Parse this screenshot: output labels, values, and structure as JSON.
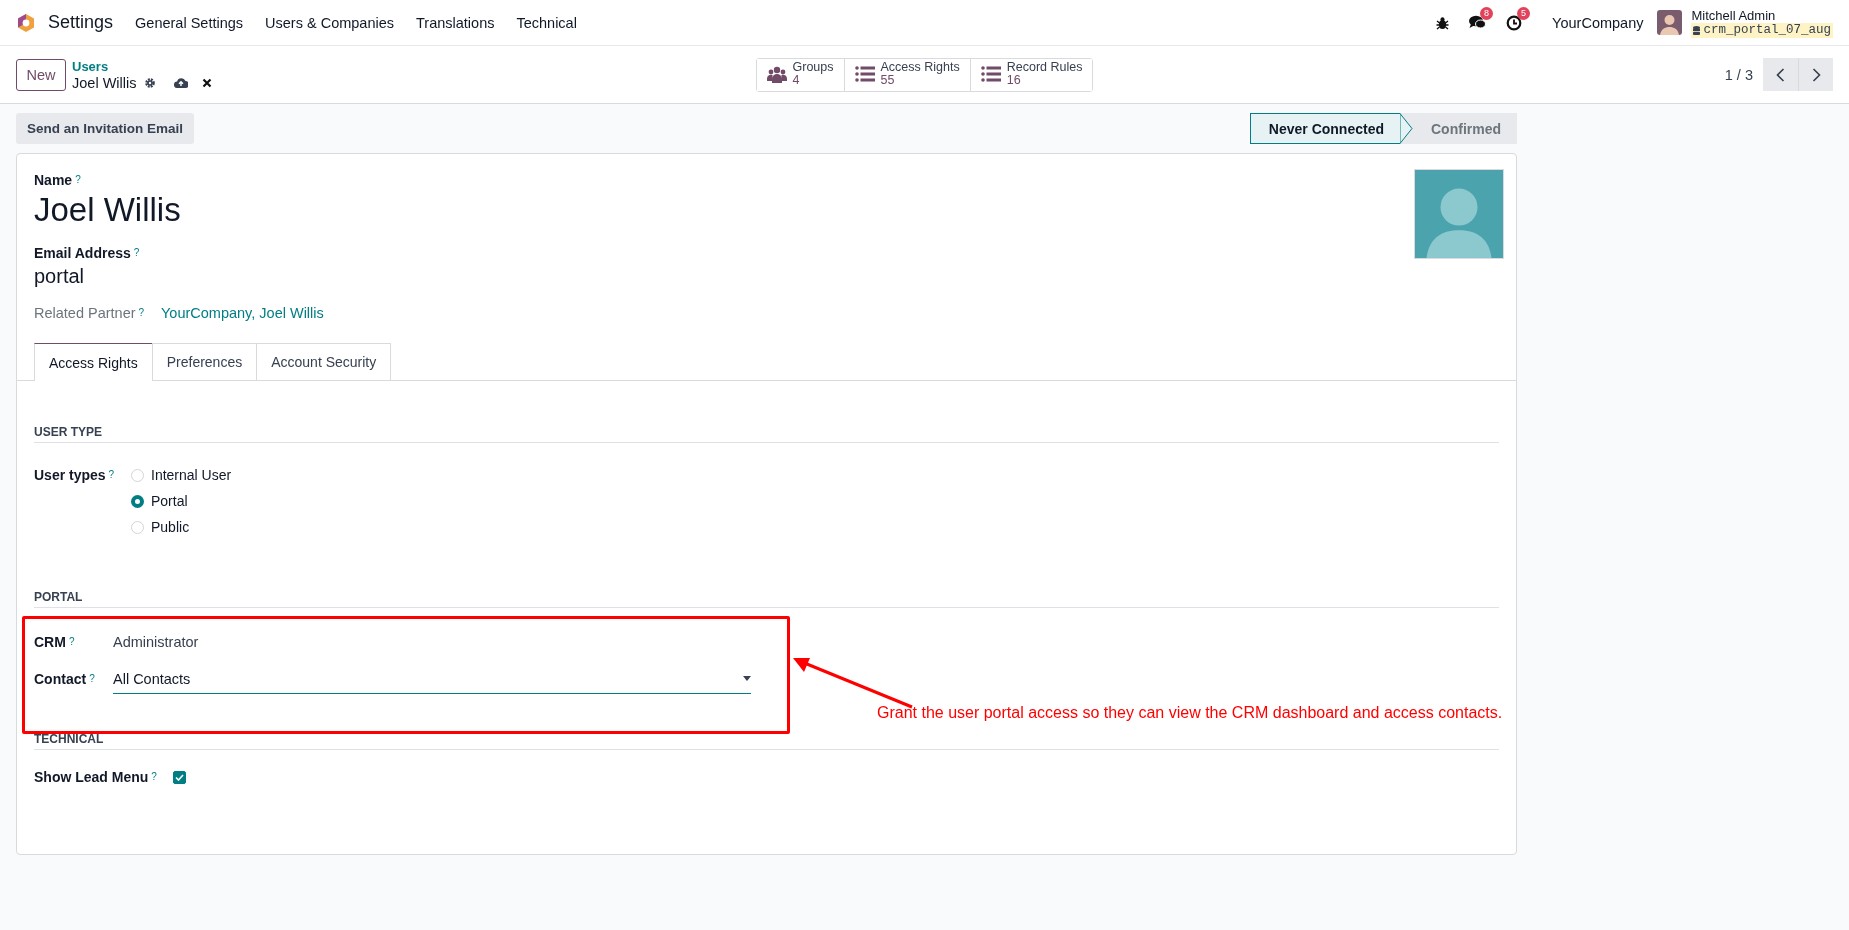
{
  "navbar": {
    "app_name": "Settings",
    "menu": [
      "General Settings",
      "Users & Companies",
      "Translations",
      "Technical"
    ],
    "messages_count": "8",
    "activities_count": "5",
    "company": "YourCompany",
    "user_name": "Mitchell Admin",
    "database": "crm_portal_07_aug"
  },
  "control_panel": {
    "new_button": "New",
    "breadcrumb_parent": "Users",
    "record_title": "Joel Willis",
    "smart_buttons": [
      {
        "kind": "groups",
        "label": "Groups",
        "count": "4"
      },
      {
        "kind": "list",
        "label": "Access Rights",
        "count": "55"
      },
      {
        "kind": "list",
        "label": "Record Rules",
        "count": "16"
      }
    ],
    "pager": "1 / 3"
  },
  "status_bar": {
    "action_button": "Send an Invitation Email",
    "stages": [
      {
        "label": "Never Connected",
        "selected": true
      },
      {
        "label": "Confirmed",
        "selected": false
      }
    ]
  },
  "form": {
    "name": {
      "label": "Name",
      "help": "?",
      "value": "Joel Willis"
    },
    "email": {
      "label": "Email Address",
      "help": "?",
      "value": "portal"
    },
    "partner": {
      "label": "Related Partner",
      "help": "?",
      "value": "YourCompany, Joel Willis"
    },
    "tabs": [
      {
        "label": "Access Rights",
        "selected": true
      },
      {
        "label": "Preferences",
        "selected": false
      },
      {
        "label": "Account Security",
        "selected": false
      }
    ],
    "sections": [
      {
        "title": "USER TYPE",
        "fields": [
          {
            "kind": "radio",
            "label": "User types",
            "help": "?",
            "options": [
              {
                "label": "Internal User",
                "selected": false
              },
              {
                "label": "Portal",
                "selected": true
              },
              {
                "label": "Public",
                "selected": false
              }
            ]
          }
        ]
      },
      {
        "title": "PORTAL",
        "fields": [
          {
            "kind": "text",
            "label": "CRM",
            "help": "?",
            "value": "Administrator"
          },
          {
            "kind": "select",
            "label": "Contact",
            "help": "?",
            "value": "All Contacts"
          }
        ]
      },
      {
        "title": "TECHNICAL",
        "fields": [
          {
            "kind": "checkbox",
            "label": "Show Lead Menu",
            "help": "?",
            "checked": true
          }
        ]
      }
    ]
  },
  "annotation": {
    "text": "Grant the user portal access so they can view the CRM dashboard and access contacts."
  }
}
